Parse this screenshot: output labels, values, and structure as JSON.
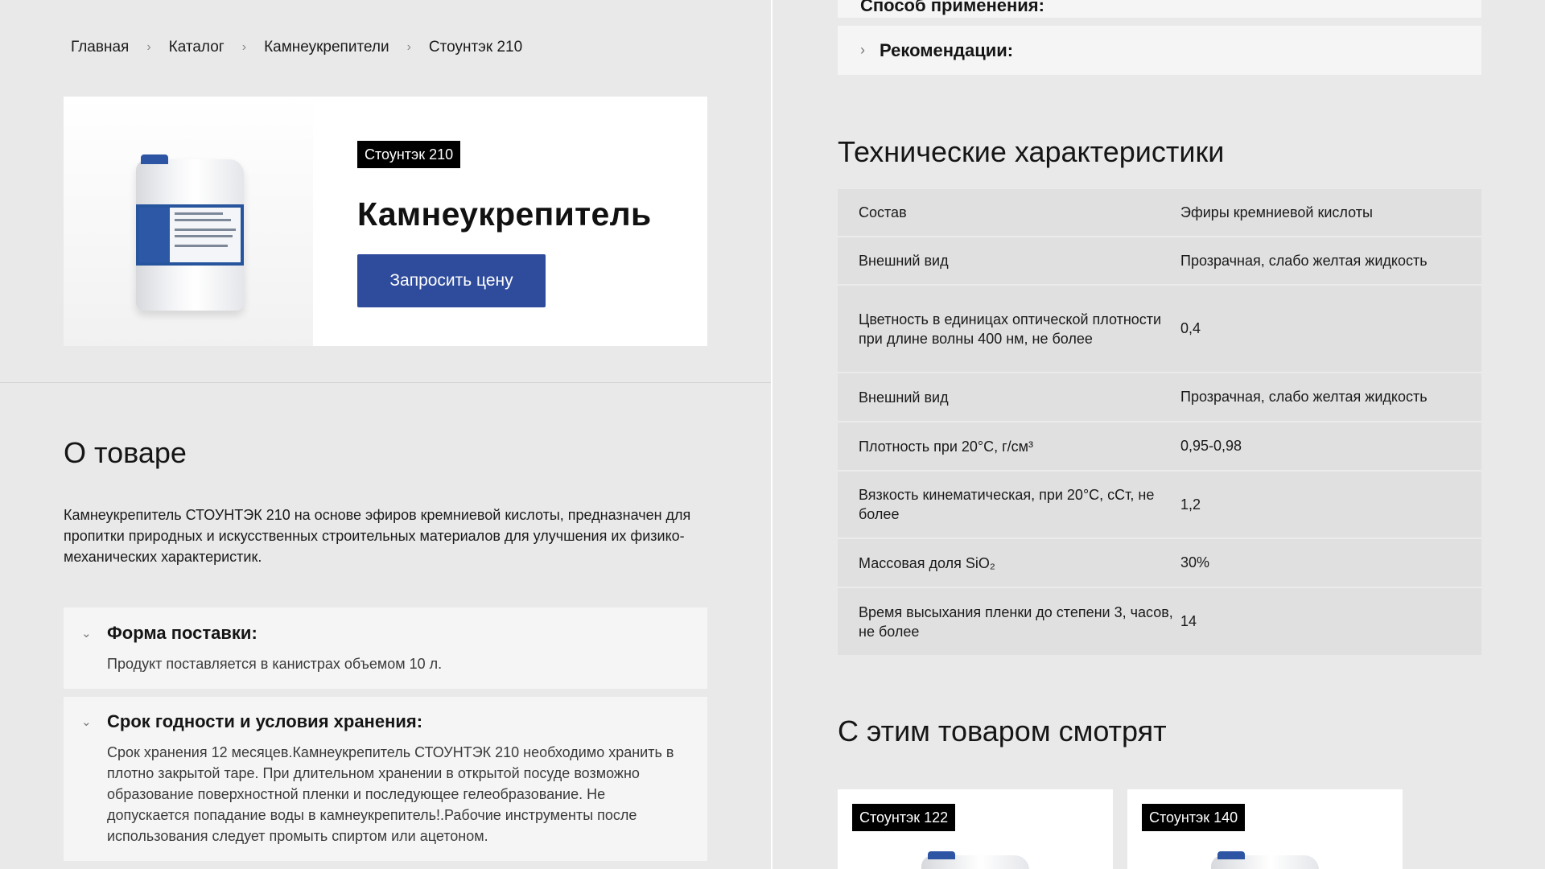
{
  "breadcrumb": {
    "items": [
      "Главная",
      "Каталог",
      "Камнеукрепители",
      "Стоунтэк 210"
    ],
    "separator": "›"
  },
  "hero": {
    "badge": "Стоунтэк 210",
    "title": "Камнеукрепитель",
    "button_label": "Запросить цену"
  },
  "about": {
    "title": "О товаре",
    "text": "Камнеукрепитель СТОУНТЭК 210 на основе эфиров кремниевой кислоты, предназначен для пропитки природных и искусственных строительных материалов для улучшения их физико-механических характеристик."
  },
  "accordions": [
    {
      "title": "Форма поставки:",
      "body": "Продукт поставляется в канистрах объемом 10 л."
    },
    {
      "title": "Срок годности и условия хранения:",
      "body": "Срок хранения 12 месяцев.Камнеукрепитель СТОУНТЭК 210 необходимо хранить в плотно закрытой таре. При длительном хранении в открытой посуде возможно образование поверхностной пленки и последующее гелеобразование. Не допускается попадание воды в камнеукрепитель!.Рабочие инструменты после использования следует промыть спиртом или ацетоном."
    }
  ],
  "right_accordions": [
    {
      "title": "Способ применения:"
    },
    {
      "title": "Рекомендации:"
    }
  ],
  "tech": {
    "title": "Технические характеристики",
    "rows": [
      {
        "key": "Состав",
        "value": "Эфиры кремниевой кислоты"
      },
      {
        "key": "Внешний вид",
        "value": "Прозрачная, слабо желтая жидкость"
      },
      {
        "key": "Цветность в единицах оптической плотности при длине волны 400 нм, не более",
        "value": "0,4"
      },
      {
        "key": "Внешний вид",
        "value": "Прозрачная, слабо желтая жидкость"
      },
      {
        "key": "Плотность при 20°С, г/см³",
        "value": "0,95-0,98"
      },
      {
        "key": "Вязкость кинематическая, при 20°С, сСт, не более",
        "value": "1,2"
      },
      {
        "key": "Массовая доля SiO₂",
        "value": "30%"
      },
      {
        "key": "Время высыхания пленки до степени 3, часов, не более",
        "value": "14"
      }
    ]
  },
  "related": {
    "title": "С этим товаром смотрят",
    "cards": [
      {
        "badge": "Стоунтэк 122"
      },
      {
        "badge": "Стоунтэк 140"
      }
    ]
  },
  "colors": {
    "background": "#e9e9e9",
    "button": "#2f4b9c",
    "badge": "#000000",
    "table": "#e0e0e0"
  }
}
